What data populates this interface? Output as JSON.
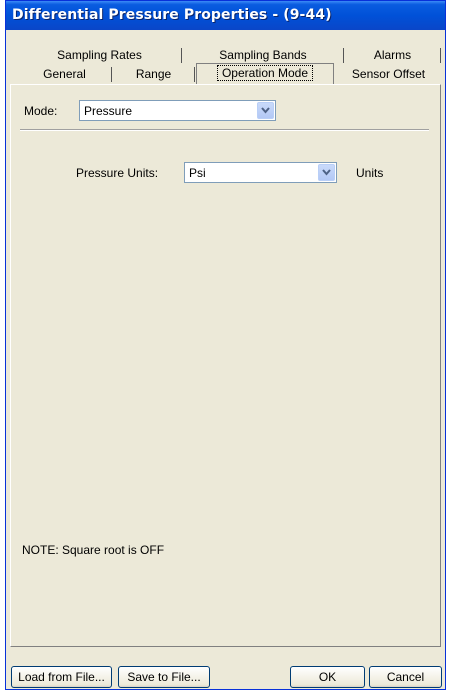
{
  "window": {
    "title": "Differential Pressure Properties -  (9-44)"
  },
  "tabs": {
    "row1": [
      {
        "label": "Sampling Rates"
      },
      {
        "label": "Sampling Bands"
      },
      {
        "label": "Alarms"
      }
    ],
    "row2": [
      {
        "label": "General"
      },
      {
        "label": "Range"
      },
      {
        "label": "Operation Mode",
        "active": true
      },
      {
        "label": "Sensor Offset"
      }
    ]
  },
  "mode": {
    "label": "Mode:",
    "value": "Pressure"
  },
  "pressure_units": {
    "label": "Pressure Units:",
    "value": "Psi",
    "suffix": "Units"
  },
  "note": "NOTE: Square root is OFF",
  "buttons": {
    "load": "Load from File...",
    "save": "Save to File...",
    "ok": "OK",
    "cancel": "Cancel"
  },
  "colors": {
    "titlebar": "#0051d8",
    "dialog_bg": "#ece9d8",
    "combo_border": "#7f9db9"
  }
}
